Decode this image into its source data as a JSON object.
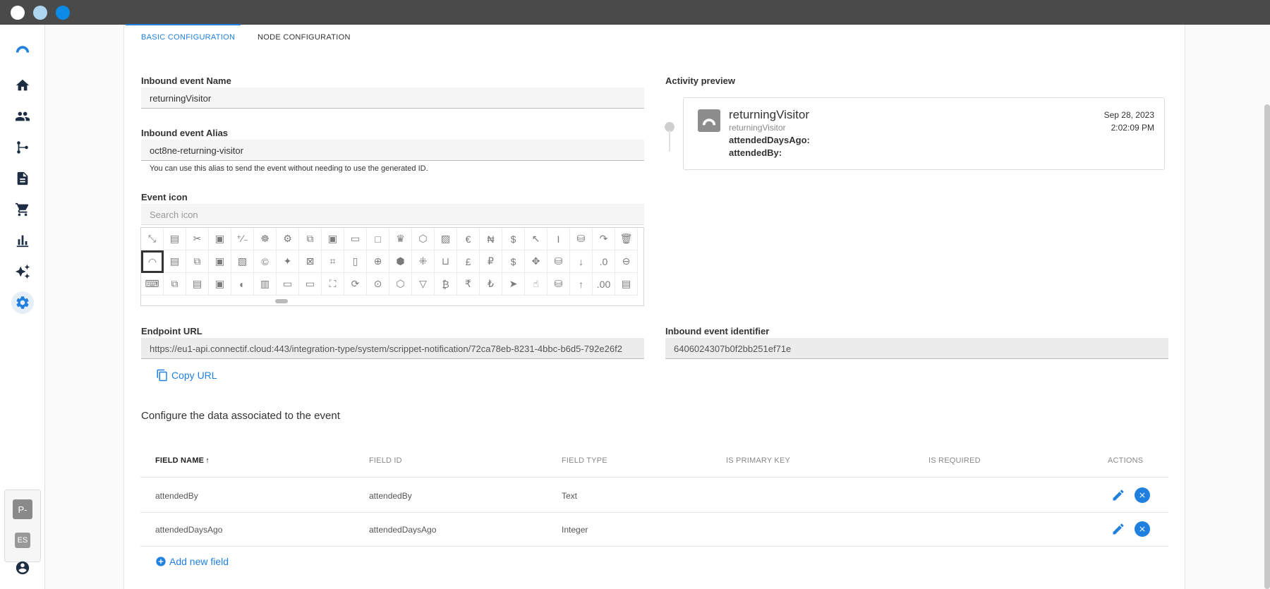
{
  "colors": {
    "accent": "#1f80e0",
    "chrome": "#4a4a4a",
    "close": "#ffffff",
    "minimize": "#aed6f1",
    "zoom": "#0b8ae6"
  },
  "sidebar": {
    "items": [
      {
        "icon": "logo-icon"
      },
      {
        "icon": "home-icon"
      },
      {
        "icon": "people-icon"
      },
      {
        "icon": "workflow-icon"
      },
      {
        "icon": "document-icon"
      },
      {
        "icon": "cart-icon"
      },
      {
        "icon": "chart-icon"
      },
      {
        "icon": "sparkle-icon"
      },
      {
        "icon": "gear-icon",
        "active": true
      }
    ],
    "account_badge": "P-",
    "language_badge": "ES",
    "user_icon": "account-circle-icon"
  },
  "tabs": [
    {
      "label": "BASIC CONFIGURATION",
      "active": true
    },
    {
      "label": "NODE CONFIGURATION",
      "active": false
    }
  ],
  "form": {
    "name_label": "Inbound event Name",
    "name_value": "returningVisitor",
    "alias_label": "Inbound event Alias",
    "alias_value": "oct8ne-returning-visitor",
    "alias_hint": "You can use this alias to send the event without needing to use the generated ID.",
    "icon_label": "Event icon",
    "icon_search_placeholder": "Search icon",
    "endpoint_label": "Endpoint URL",
    "endpoint_value": "https://eu1-api.connectif.cloud:443/integration-type/system/scrippet-notification/72ca78eb-8231-4bbc-b6d5-792e26f2",
    "copy_url_label": "Copy URL",
    "identifier_label": "Inbound event identifier",
    "identifier_value": "6406024307b0f2bb251ef71e"
  },
  "preview": {
    "label": "Activity preview",
    "title": "returningVisitor",
    "subtitle": "returningVisitor",
    "field1": "attendedDaysAgo:",
    "field2": "attendedBy:",
    "date": "Sep 28, 2023",
    "time": "2:02:09 PM"
  },
  "icon_grid": {
    "rows": [
      [
        "⤡",
        "▤",
        "✂",
        "▣",
        "⁺⁄₋",
        "☸",
        "⚙",
        "⧉",
        "▣",
        "▭",
        "□",
        "♛",
        "⬡",
        "▨",
        "€",
        "₦",
        "$",
        "↖",
        "I",
        "⛁",
        "↷",
        "🗑"
      ],
      [
        "◠",
        "▤",
        "⧉",
        "▣",
        "▧",
        "©",
        "✦",
        "⊠",
        "⌗",
        "▯",
        "⊕",
        "⬢",
        "⁜",
        "⊔",
        "£",
        "₽",
        "$",
        "✥",
        "⛁",
        "↓",
        ".0",
        "⊖"
      ],
      [
        "⌨",
        "⧉",
        "▤",
        "▣",
        "◐",
        "▥",
        "▭",
        "▭",
        "⛶",
        "⟳",
        "⊙",
        "⬡",
        "▽",
        "₿",
        "₹",
        "₺",
        "➤",
        "☝",
        "⛁",
        "↑",
        ".00",
        "▤"
      ]
    ]
  },
  "data_section": {
    "title": "Configure the data associated to the event",
    "columns": [
      "FIELD NAME",
      "FIELD ID",
      "FIELD TYPE",
      "IS PRIMARY KEY",
      "IS REQUIRED",
      "ACTIONS"
    ],
    "rows": [
      {
        "name": "attendedBy",
        "id": "attendedBy",
        "type": "Text"
      },
      {
        "name": "attendedDaysAgo",
        "id": "attendedDaysAgo",
        "type": "Integer"
      }
    ],
    "add_field_label": "Add new field"
  }
}
